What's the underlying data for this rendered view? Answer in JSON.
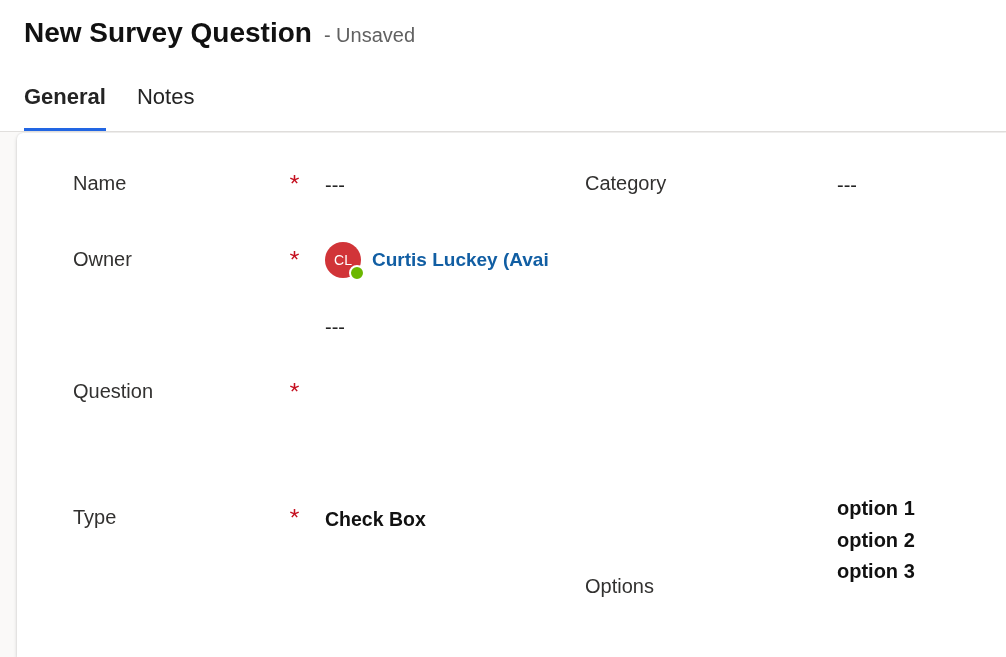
{
  "header": {
    "title": "New Survey Question",
    "status": "- Unsaved"
  },
  "tabs": [
    {
      "label": "General",
      "selected": true
    },
    {
      "label": "Notes",
      "selected": false
    }
  ],
  "form": {
    "rows": [
      {
        "left": {
          "kind": "text",
          "label": "Name",
          "required": true,
          "value": "---"
        },
        "right": {
          "kind": "text",
          "label": "Category",
          "required": false,
          "value": "---"
        }
      },
      {
        "left": {
          "kind": "lookup",
          "label": "Owner",
          "required": true,
          "initials": "CL",
          "available": true,
          "value": "Curtis Luckey (Avai"
        }
      },
      {
        "left": {
          "kind": "text",
          "required": false,
          "value": "---"
        }
      },
      {
        "left": {
          "kind": "multiline",
          "label": "Question",
          "required": true
        }
      },
      {
        "left": {
          "kind": "choice",
          "label": "Type",
          "required": true,
          "value": "Check Box"
        },
        "right": {
          "kind": "list",
          "label": "Options",
          "required": false,
          "values": [
            "option 1",
            "option 2",
            "option 3"
          ]
        }
      }
    ]
  }
}
